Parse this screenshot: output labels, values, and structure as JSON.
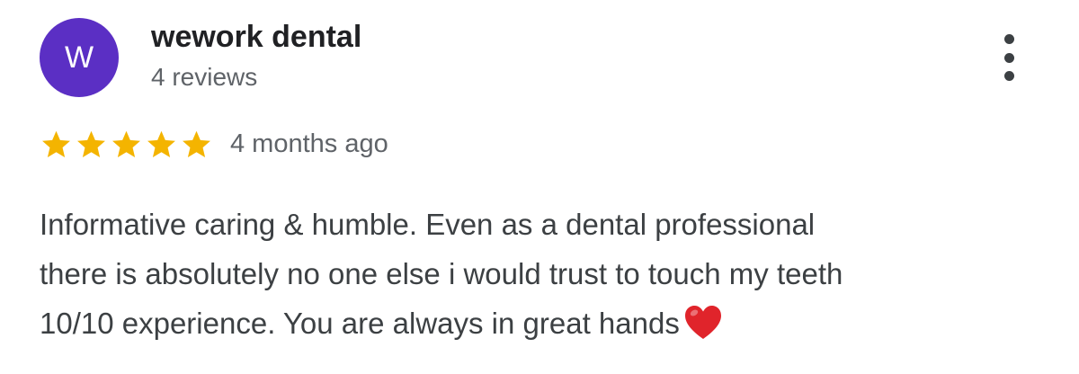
{
  "reviewer": {
    "initial": "W",
    "name": "wework dental",
    "review_count": "4 reviews",
    "avatar_color": "#5b2fc4"
  },
  "more_menu_icon": "more-vert-icon",
  "rating": {
    "stars": 5,
    "max": 5,
    "star_color": "#f4b400",
    "time_ago": "4 months ago"
  },
  "review": {
    "lines": [
      "Informative caring & humble. Even as a dental professional",
      "there is absolutely no one else i would trust to touch my teeth",
      "10/10 experience. You are always in great hands"
    ],
    "trailing_emoji": "heart-icon",
    "emoji_color": "#e0242b"
  }
}
